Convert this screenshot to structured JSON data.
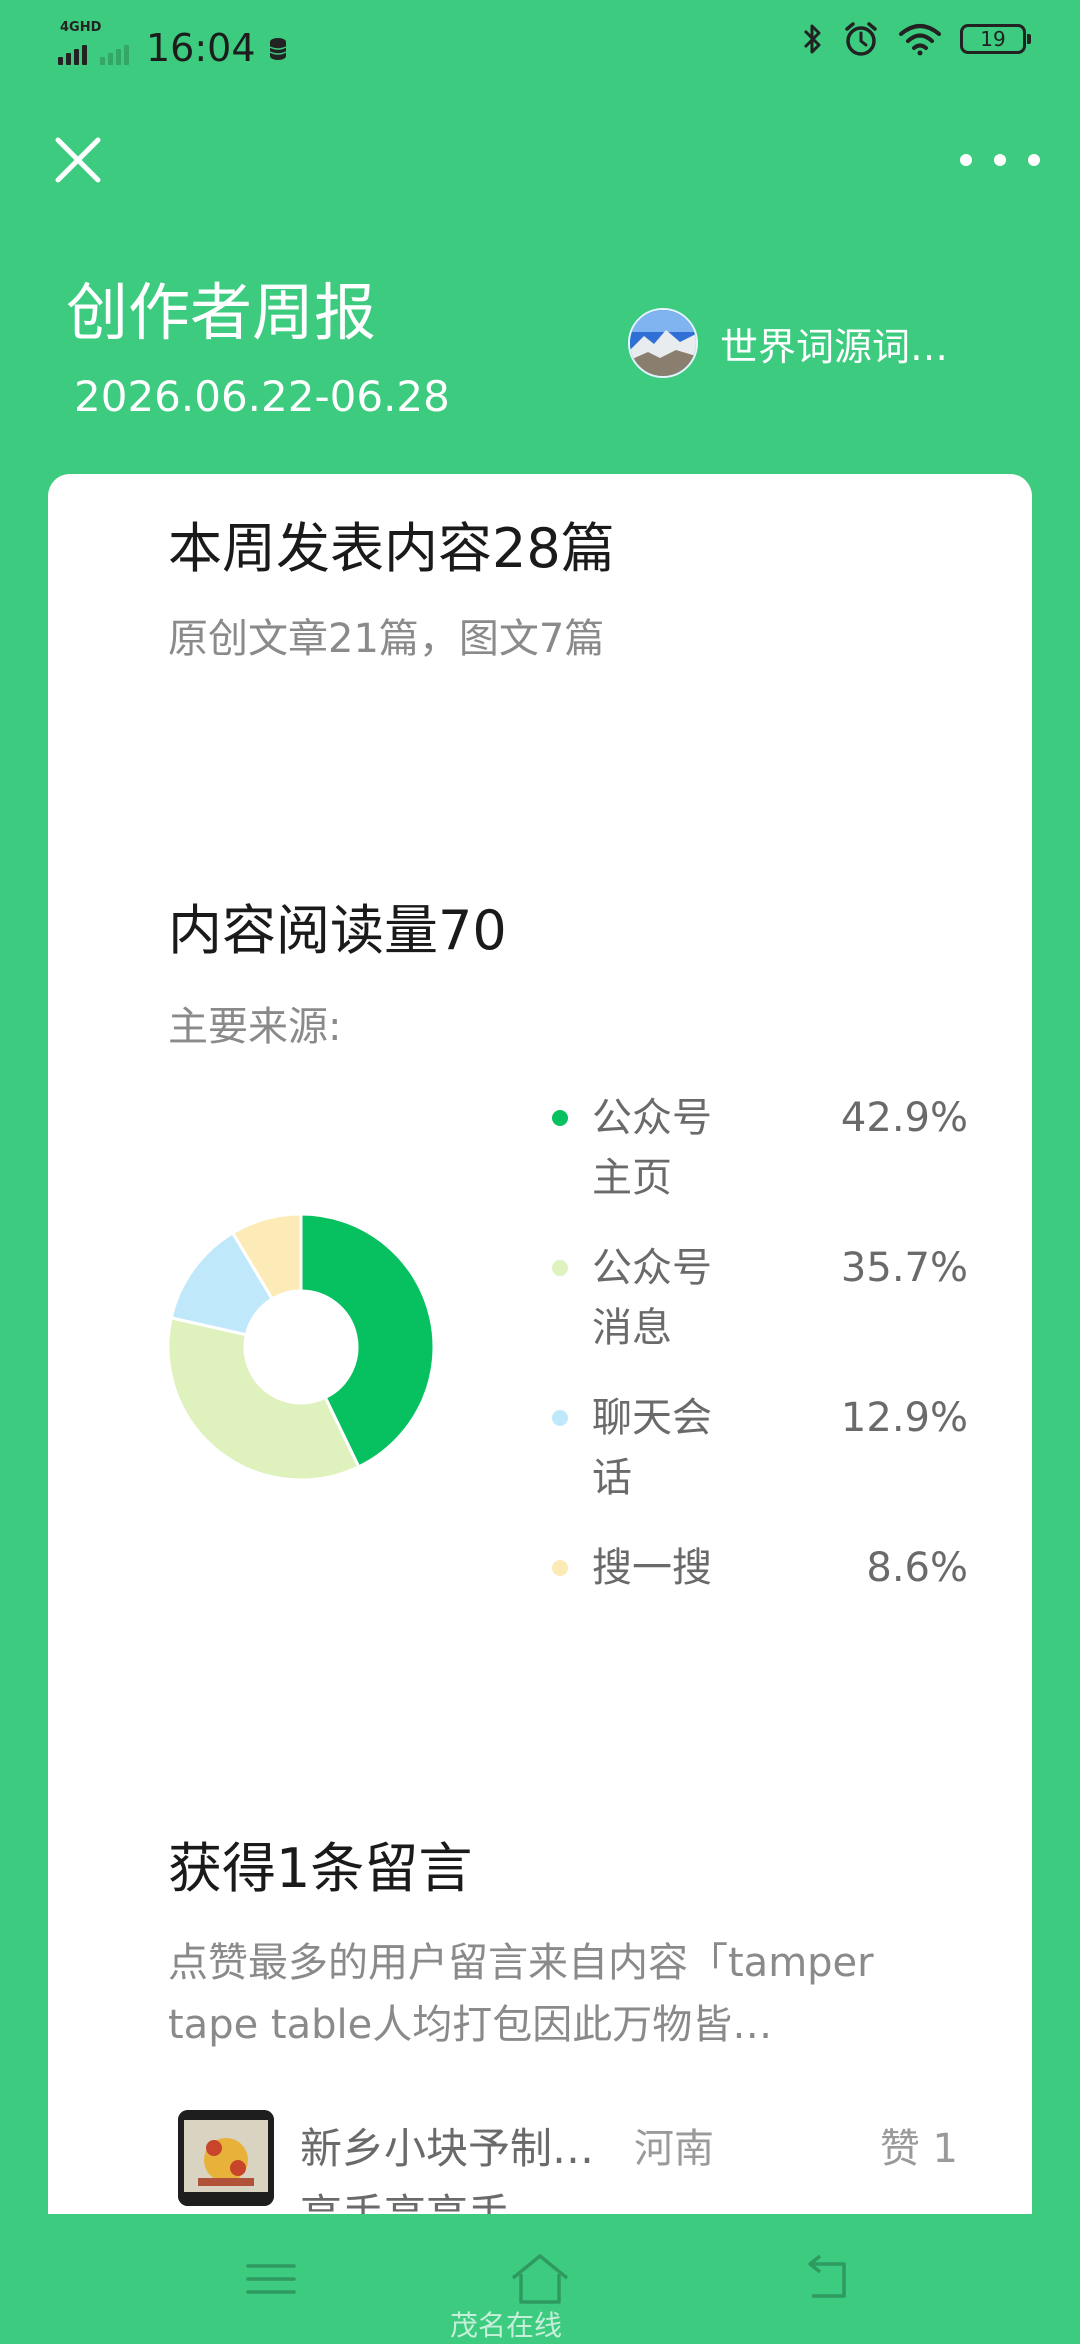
{
  "status_bar": {
    "network": "4GHD",
    "time": "16:04",
    "battery": "19"
  },
  "header": {
    "title": "创作者周报",
    "date_range": "2026.06.22-06.28",
    "account_name": "世界词源词…"
  },
  "publish": {
    "title": "本周发表内容28篇",
    "subtitle": "原创文章21篇，图文7篇"
  },
  "reads": {
    "title": "内容阅读量70",
    "subtitle": "主要来源:"
  },
  "chart_data": {
    "type": "pie",
    "categories": [
      "公众号主页",
      "公众号消息",
      "聊天会话",
      "搜一搜"
    ],
    "values": [
      42.9,
      35.7,
      12.9,
      8.6
    ],
    "colors": [
      "#07c160",
      "#dff2bd",
      "#bfe8fb",
      "#fdebb7"
    ],
    "donut": true
  },
  "legend": [
    {
      "label": "公众号主页",
      "pct": "42.9%",
      "color": "#07c160"
    },
    {
      "label": "公众号消息",
      "pct": "35.7%",
      "color": "#dff2bd"
    },
    {
      "label": "聊天会话",
      "pct": "12.9%",
      "color": "#bfe8fb"
    },
    {
      "label": "搜一搜",
      "pct": "8.6%",
      "color": "#fdebb7"
    }
  ],
  "comments": {
    "title": "获得1条留言",
    "subtitle": "点赞最多的用户留言来自内容「tamper tape table人均打包因此万物皆…",
    "top_comment": {
      "title": "新乡小块予制… 高手高高手",
      "region": "河南",
      "likes": "赞 1"
    }
  },
  "watermark": "茂名在线",
  "colors": {
    "brand_green": "#3ccb7f",
    "card_bg": "#ffffff"
  }
}
